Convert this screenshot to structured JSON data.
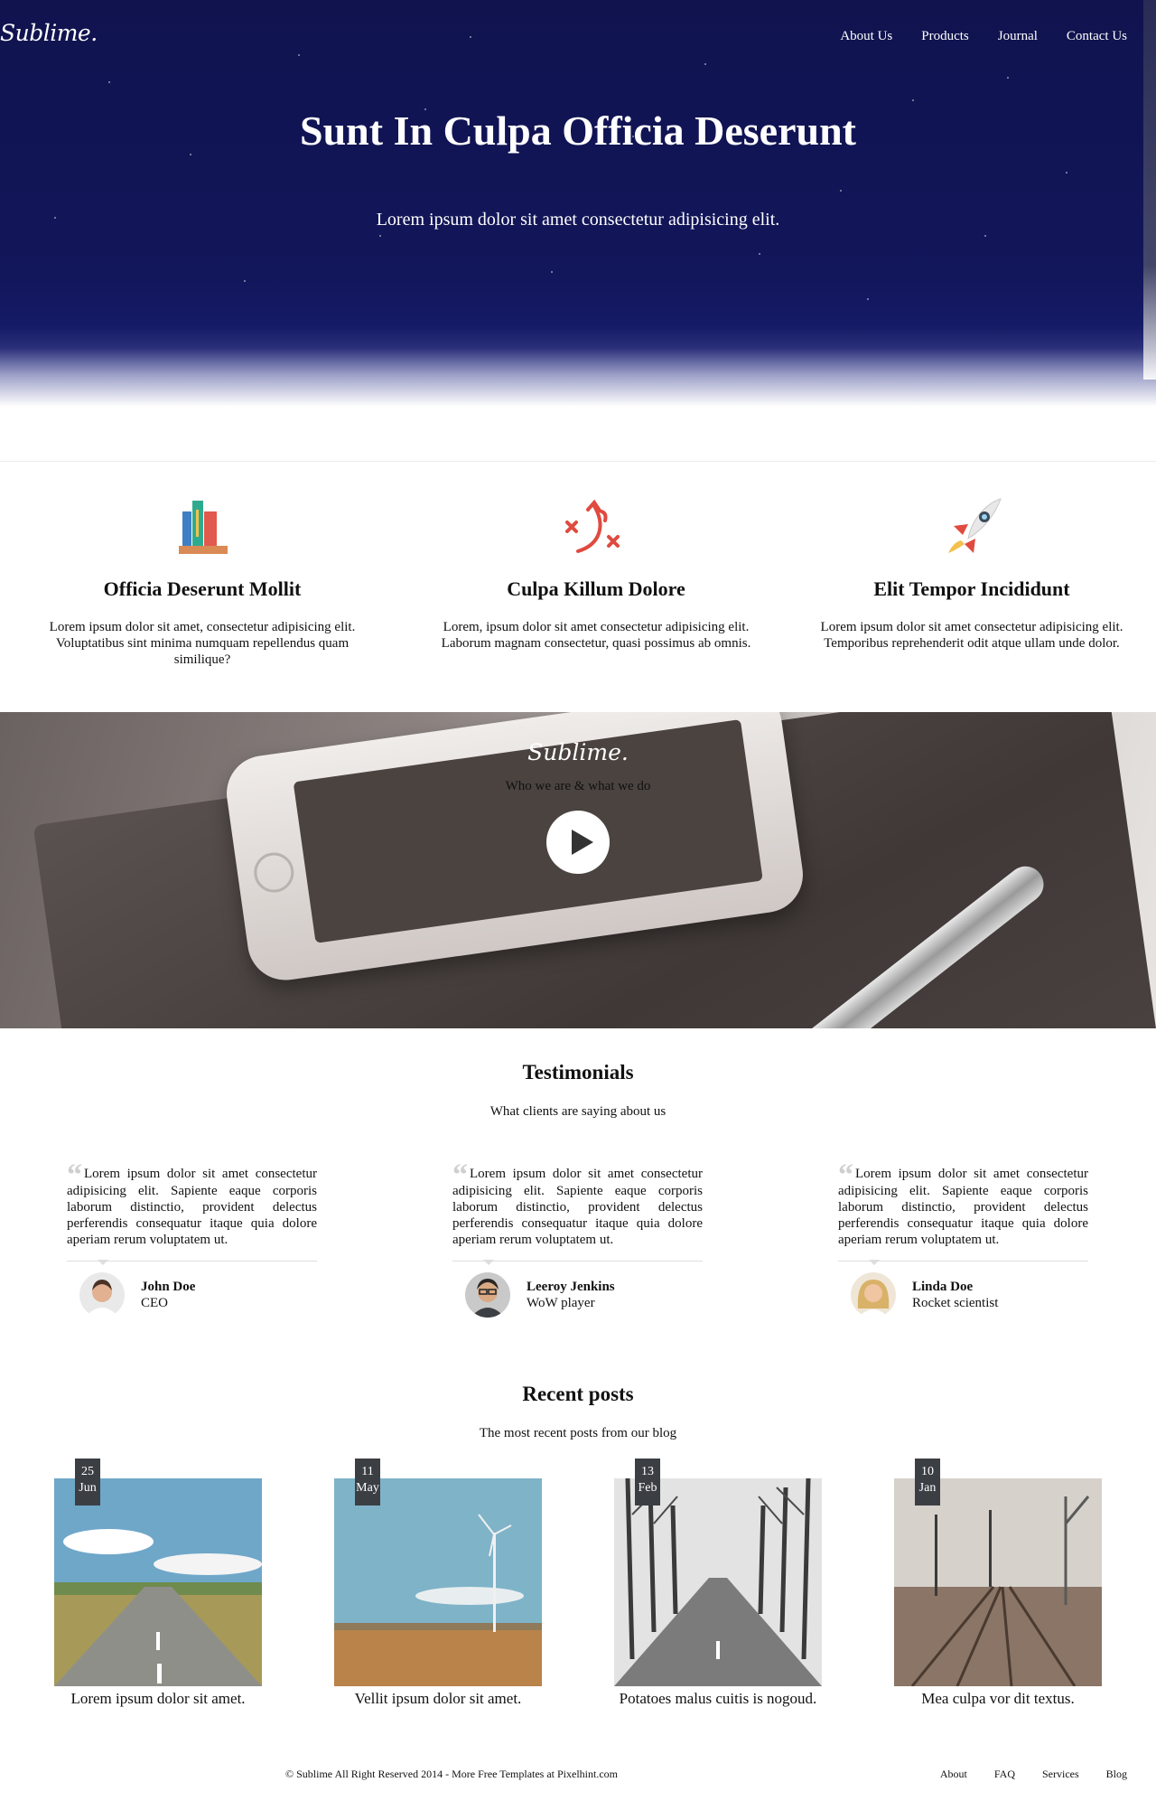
{
  "header": {
    "logo": "Sublime.",
    "nav": [
      "About Us",
      "Products",
      "Journal",
      "Contact Us"
    ]
  },
  "hero": {
    "title": "Sunt In Culpa Officia Deserunt",
    "subtitle": "Lorem ipsum dolor sit amet consectetur adipisicing elit."
  },
  "features": [
    {
      "icon": "books-icon",
      "title": "Officia Deserunt Mollit",
      "text": "Lorem ipsum dolor sit amet, consectetur adipisicing elit. Voluptatibus sint minima numquam repellendus quam similique?"
    },
    {
      "icon": "strategy-icon",
      "title": "Culpa Killum Dolore",
      "text": "Lorem, ipsum dolor sit amet consectetur adipisicing elit. Laborum magnam consectetur, quasi possimus ab omnis."
    },
    {
      "icon": "rocket-icon",
      "title": "Elit Tempor Incididunt",
      "text": "Lorem ipsum dolor sit amet consectetur adipisicing elit. Temporibus reprehenderit odit atque ullam unde dolor."
    }
  ],
  "video": {
    "logo": "Sublime.",
    "subtitle": "Who we are & what we do"
  },
  "testimonials": {
    "title": "Testimonials",
    "subtitle": "What clients are saying about us",
    "items": [
      {
        "quote": "Lorem ipsum dolor sit amet consectetur adipisicing elit. Sapiente eaque corporis laborum distinctio, provident delectus perferendis consequatur itaque quia dolore aperiam rerum voluptatem ut.",
        "name": "John Doe",
        "role": "CEO"
      },
      {
        "quote": "Lorem ipsum dolor sit amet consectetur adipisicing elit. Sapiente eaque corporis laborum distinctio, provident delectus perferendis consequatur itaque quia dolore aperiam rerum voluptatem ut.",
        "name": "Leeroy Jenkins",
        "role": "WoW player"
      },
      {
        "quote": "Lorem ipsum dolor sit amet consectetur adipisicing elit. Sapiente eaque corporis laborum distinctio, provident delectus perferendis consequatur itaque quia dolore aperiam rerum voluptatem ut.",
        "name": "Linda Doe",
        "role": "Rocket scientist"
      }
    ]
  },
  "posts": {
    "title": "Recent posts",
    "subtitle": "The most recent posts from our blog",
    "items": [
      {
        "day": "25",
        "month": "Jun",
        "title": "Lorem ipsum dolor sit amet."
      },
      {
        "day": "11",
        "month": "May",
        "title": "Vellit ipsum dolor sit amet."
      },
      {
        "day": "13",
        "month": "Feb",
        "title": "Potatoes malus cuitis is nogoud."
      },
      {
        "day": "10",
        "month": "Jan",
        "title": "Mea culpa vor dit textus."
      }
    ]
  },
  "footer": {
    "copyright": "© Sublime All Right Reserved 2014 - More Free Templates at Pixelhint.com",
    "links": [
      "About",
      "FAQ",
      "Services",
      "Blog"
    ]
  }
}
